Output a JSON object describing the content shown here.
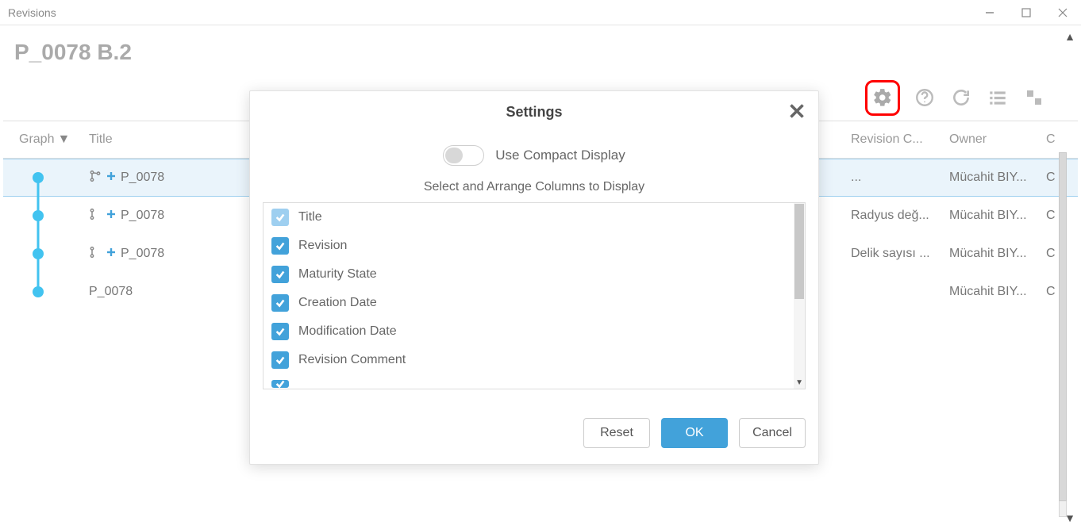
{
  "window": {
    "title": "Revisions"
  },
  "page": {
    "title": "P_0078 B.2"
  },
  "columns": {
    "graph": "Graph",
    "title": "Title",
    "revision_comment": "Revision C...",
    "owner": "Owner",
    "last": "C"
  },
  "rows": [
    {
      "title": "P_0078",
      "revision_comment": "...",
      "owner": "Mücahit BIY...",
      "last": "C",
      "has_branch_icon": true,
      "has_plus_icon": true,
      "selected": true
    },
    {
      "title": "P_0078",
      "revision_comment": "Radyus değ...",
      "owner": "Mücahit BIY...",
      "last": "C",
      "has_branch_icon": true,
      "has_plus_icon": true,
      "selected": false
    },
    {
      "title": "P_0078",
      "revision_comment": "Delik sayısı ...",
      "owner": "Mücahit BIY...",
      "last": "C",
      "has_branch_icon": true,
      "has_plus_icon": true,
      "selected": false
    },
    {
      "title": "P_0078",
      "revision_comment": "",
      "owner": "Mücahit BIY...",
      "last": "C",
      "has_branch_icon": false,
      "has_plus_icon": false,
      "selected": false
    }
  ],
  "modal": {
    "title": "Settings",
    "compact_label": "Use Compact Display",
    "arrange_label": "Select and Arrange Columns to Display",
    "columns": [
      {
        "label": "Title",
        "checked": true,
        "disabled": true
      },
      {
        "label": "Revision",
        "checked": true,
        "disabled": false
      },
      {
        "label": "Maturity State",
        "checked": true,
        "disabled": false
      },
      {
        "label": "Creation Date",
        "checked": true,
        "disabled": false
      },
      {
        "label": "Modification Date",
        "checked": true,
        "disabled": false
      },
      {
        "label": "Revision Comment",
        "checked": true,
        "disabled": false
      }
    ],
    "buttons": {
      "reset": "Reset",
      "ok": "OK",
      "cancel": "Cancel"
    }
  }
}
